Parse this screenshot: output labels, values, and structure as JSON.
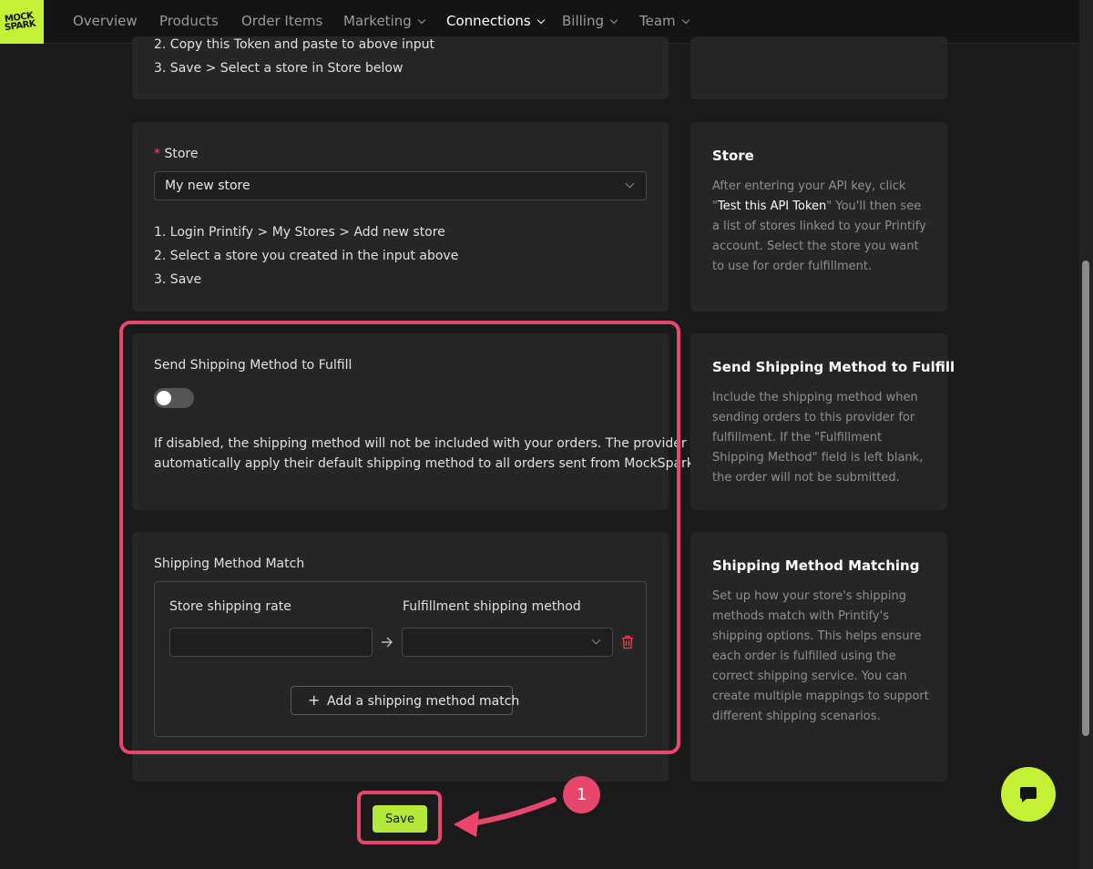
{
  "brand": {
    "line1": "MOCK",
    "line2": "SPARK",
    "accent": "#c5f135"
  },
  "nav": {
    "items": [
      {
        "label": "Overview",
        "dropdown": false
      },
      {
        "label": "Products",
        "dropdown": false
      },
      {
        "label": "Order Items",
        "dropdown": false
      },
      {
        "label": "Marketing",
        "dropdown": true
      },
      {
        "label": "Connections",
        "dropdown": true,
        "active": true
      },
      {
        "label": "Billing",
        "dropdown": true
      },
      {
        "label": "Team",
        "dropdown": true
      }
    ]
  },
  "token_card": {
    "step2": "2. Copy this Token and paste to above input",
    "step3": "3. Save > Select a store in Store below"
  },
  "store_card": {
    "required_mark": "*",
    "label": "Store",
    "selected": "My new store",
    "step1": "1. Login Printify > My Stores > Add new store",
    "step2": "2. Select a store you created in the input above",
    "step3": "3. Save"
  },
  "store_side": {
    "title": "Store",
    "text_before": "After entering your API key, click \"",
    "text_bold": "Test this API Token",
    "text_after": "\" You'll then see a list of stores linked to your Printify account. Select the store you want to use for order fulfillment."
  },
  "shipping_card": {
    "label": "Send Shipping Method to Fulfill",
    "toggle_on": false,
    "description_line1": "If disabled, the shipping method will not be included with your orders. The provider will",
    "description_line2": "automatically apply their default shipping method to all orders sent from MockSpark."
  },
  "shipping_side": {
    "title": "Send Shipping Method to Fulfill",
    "text": "Include the shipping method when sending orders to this provider for fulfillment. If the \"Fulfillment Shipping Method\" field is left blank, the order will not be submitted."
  },
  "match_card": {
    "label": "Shipping Method Match",
    "col_store": "Store shipping rate",
    "col_fulfillment": "Fulfillment shipping method",
    "store_rate_value": "",
    "fulfillment_value": "",
    "add_label": "Add a shipping method match"
  },
  "match_side": {
    "title": "Shipping Method Matching",
    "text": "Set up how your store's shipping methods match with Printify's shipping options. This helps ensure each order is fulfilled using the correct shipping service. You can create multiple mappings to support different shipping scenarios."
  },
  "save_label": "Save",
  "annotation_badge": "1",
  "colors": {
    "highlight": "#e8466a",
    "save": "#b4e83a"
  }
}
